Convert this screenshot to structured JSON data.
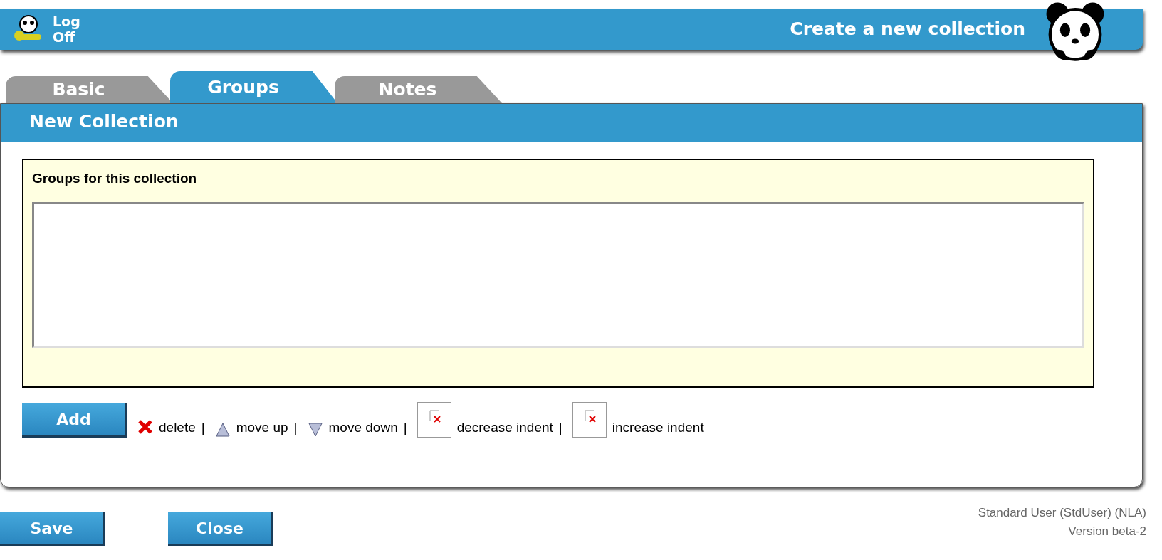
{
  "header": {
    "logoff_lines": [
      "Log",
      "Off"
    ],
    "title": "Create a new collection"
  },
  "tabs": [
    {
      "label": "Basic",
      "selected": false
    },
    {
      "label": "Groups",
      "selected": true
    },
    {
      "label": "Notes",
      "selected": false
    }
  ],
  "section_title": "New Collection",
  "groups": {
    "label": "Groups for this collection"
  },
  "add_button": "Add",
  "actions": [
    {
      "kind": "delete",
      "label": "delete",
      "separator": "|"
    },
    {
      "kind": "up",
      "label": "move up",
      "separator": "|"
    },
    {
      "kind": "down",
      "label": "move down",
      "separator": "|"
    },
    {
      "kind": "broken",
      "label": "decrease indent",
      "separator": "|"
    },
    {
      "kind": "broken",
      "label": "increase indent"
    }
  ],
  "buttons": [
    "Save",
    "Close"
  ],
  "footer": [
    "Standard User (StdUser) (NLA)",
    "Version beta-2"
  ]
}
